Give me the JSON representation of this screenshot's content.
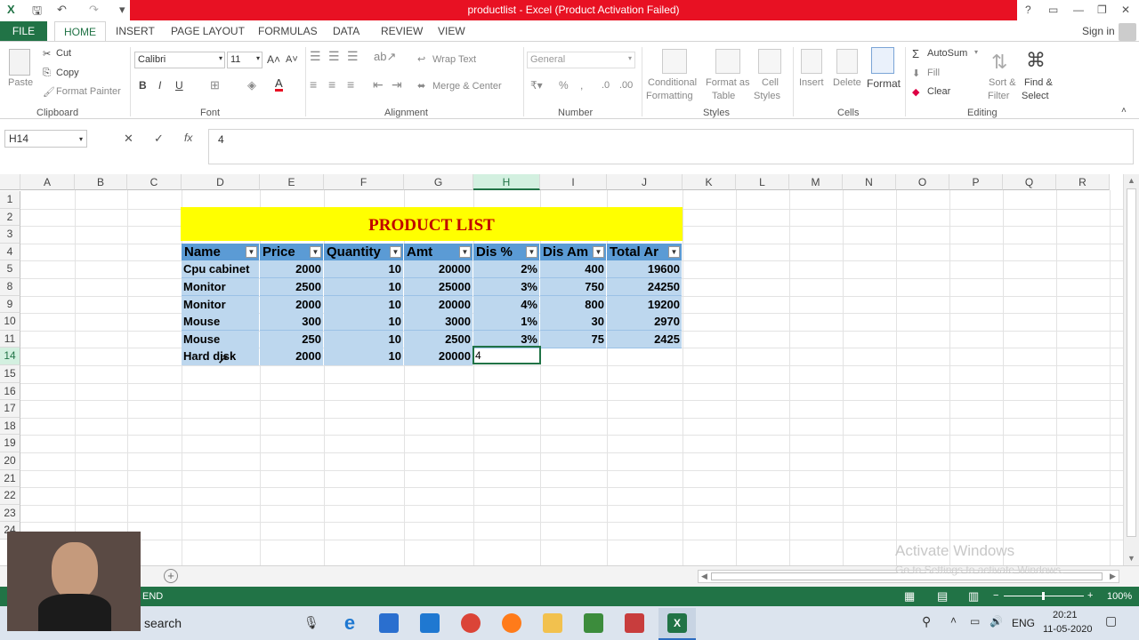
{
  "title_bar": {
    "title": "productlist - Excel (Product Activation Failed)",
    "help": "?",
    "signin": "Sign in"
  },
  "tabs": [
    "FILE",
    "HOME",
    "INSERT",
    "PAGE LAYOUT",
    "FORMULAS",
    "DATA",
    "REVIEW",
    "VIEW"
  ],
  "ribbon": {
    "clipboard": {
      "label": "Clipboard",
      "paste": "Paste",
      "cut": "Cut",
      "copy": "Copy",
      "format_painter": "Format Painter"
    },
    "font": {
      "label": "Font",
      "name": "Calibri",
      "size": "11",
      "bold": "B",
      "italic": "I",
      "underline": "U"
    },
    "alignment": {
      "label": "Alignment",
      "wrap": "Wrap Text",
      "merge": "Merge & Center"
    },
    "number": {
      "label": "Number",
      "format": "General",
      "percent": "%"
    },
    "styles": {
      "label": "Styles",
      "conditional": "Conditional",
      "conditional2": "Formatting",
      "format_table": "Format as",
      "format_table2": "Table",
      "cell_styles": "Cell",
      "cell_styles2": "Styles"
    },
    "cells": {
      "label": "Cells",
      "insert": "Insert",
      "delete": "Delete",
      "format": "Format"
    },
    "editing": {
      "label": "Editing",
      "autosum": "AutoSum",
      "fill": "Fill",
      "clear": "Clear",
      "sort": "Sort &",
      "sort2": "Filter",
      "find": "Find &",
      "find2": "Select"
    }
  },
  "formula_bar": {
    "name_box": "H14",
    "cancel": "✕",
    "enter": "✓",
    "fx": "fx",
    "value": "4"
  },
  "columns": [
    "A",
    "B",
    "C",
    "D",
    "E",
    "F",
    "G",
    "H",
    "I",
    "J",
    "K",
    "L",
    "M",
    "N",
    "O",
    "P",
    "Q",
    "R"
  ],
  "rows": [
    "1",
    "2",
    "3",
    "4",
    "5",
    "8",
    "9",
    "10",
    "11",
    "14",
    "15",
    "16",
    "17",
    "18",
    "19",
    "20",
    "21",
    "22",
    "23",
    "24"
  ],
  "table": {
    "title": "PRODUCT LIST",
    "headers": [
      "Name",
      "Price",
      "Quantity",
      "Amt",
      "Dis %",
      "Dis Am",
      "Total Ar"
    ],
    "rows": [
      [
        "Cpu cabinet",
        "2000",
        "10",
        "20000",
        "2%",
        "400",
        "19600"
      ],
      [
        "Monitor",
        "2500",
        "10",
        "25000",
        "3%",
        "750",
        "24250"
      ],
      [
        "Monitor",
        "2000",
        "10",
        "20000",
        "4%",
        "800",
        "19200"
      ],
      [
        "Mouse",
        "300",
        "10",
        "3000",
        "1%",
        "30",
        "2970"
      ],
      [
        "Mouse",
        "250",
        "10",
        "2500",
        "3%",
        "75",
        "2425"
      ],
      [
        "Hard disk",
        "2000",
        "10",
        "20000",
        "4",
        "",
        ""
      ]
    ]
  },
  "status": {
    "mode": "END",
    "zoom": "100%"
  },
  "watermark": {
    "line1": "Activate Windows",
    "line2": "Go to Settings to activate Windows."
  },
  "taskbar": {
    "search": "search",
    "lang": "ENG",
    "time": "20:21",
    "date": "11-05-2020"
  },
  "colors": {
    "excel_green": "#217346",
    "title_red": "#e81123",
    "table_header": "#5b9bd5",
    "table_row": "#bdd7ee",
    "title_band": "#ffff00",
    "title_text": "#c00000"
  }
}
